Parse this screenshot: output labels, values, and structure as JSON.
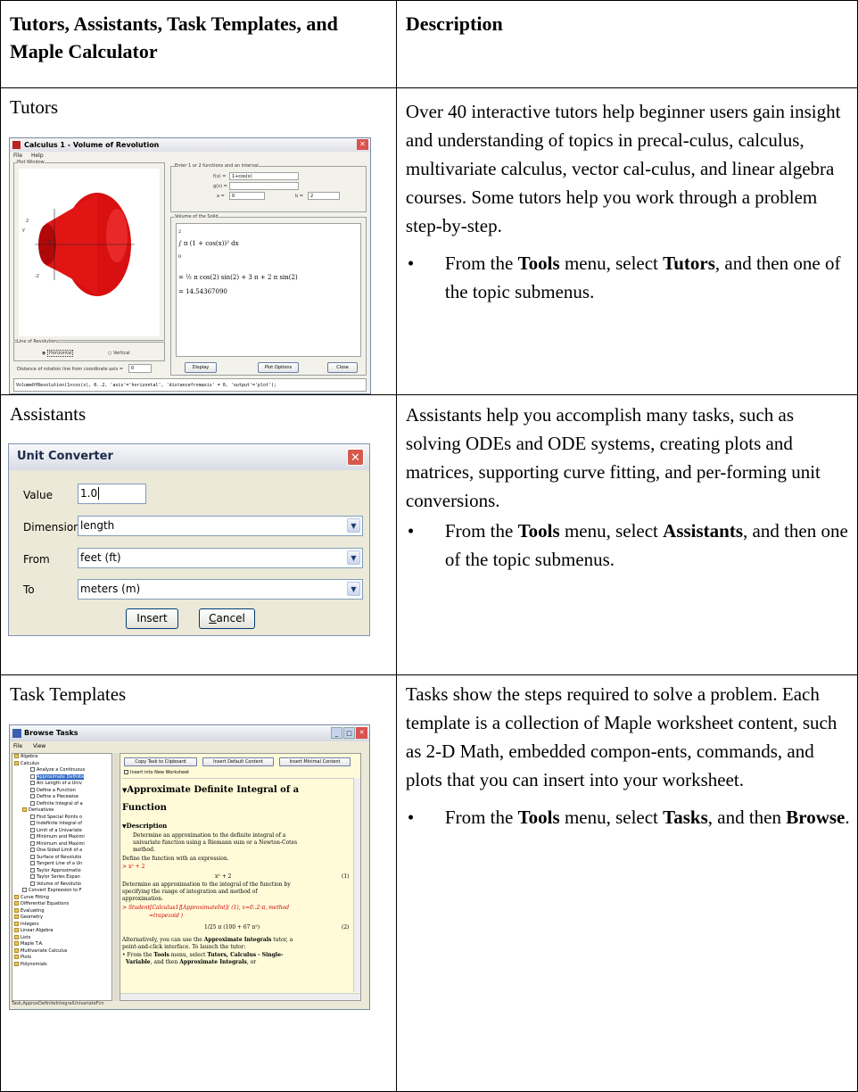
{
  "header": {
    "col1": "Tutors, Assistants, Task Templates, and Maple Calculator",
    "col2": "Description"
  },
  "rows": [
    {
      "title": "Tutors",
      "description": "Over 40 interactive tutors help beginner users gain insight and understanding of topics in precal-culus, calculus, multivariate calculus, vector cal-culus, and linear algebra courses. Some tutors help you work through a problem step-by-step.",
      "bullet": {
        "prefix": "From the ",
        "b1": "Tools",
        "mid": " menu, select ",
        "b2": "Tutors",
        "suffix": ", and then one of the topic submenus."
      }
    },
    {
      "title": "Assistants",
      "description": "Assistants help you accomplish many tasks, such as solving ODEs and ODE systems, creating plots and matrices, supporting curve fitting, and per-forming unit conversions.",
      "bullet": {
        "prefix": "From the ",
        "b1": "Tools",
        "mid": " menu, select ",
        "b2": "Assistants",
        "suffix": ", and then one of the topic submenus."
      }
    },
    {
      "title": "Task Templates",
      "description": "Tasks show the steps required to solve a problem. Each template is a collection of Maple worksheet content, such as 2-D Math, embedded compon-ents, commands, and plots that you can insert into your worksheet.",
      "bullet": {
        "prefix": "From the ",
        "b1": "Tools",
        "mid": " menu, select ",
        "b2": "Tasks",
        "suffix": ", and then ",
        "b3": "Browse",
        "end": "."
      }
    }
  ],
  "tutor_window": {
    "title": "Calculus 1 - Volume of Revolution",
    "menu": [
      "File",
      "Help"
    ],
    "plot_window": "Plot Window",
    "enter_label": "Enter 1 or 2 functions and an interval",
    "f_label": "f(x) =",
    "f_value": "1+cos(x)",
    "g_label": "g(x) =",
    "a_label": "a =",
    "a_value": "0",
    "b_label": "b =",
    "b_value": "2",
    "volume_label": "Volume of the Solid",
    "integral": "∫ π (1 + cos(x))² dx",
    "int_upper": "2",
    "int_lower": "0",
    "expr": "= ½ π cos(2) sin(2) + 3 π + 2 π sin(2)",
    "result": "= 14.54367090",
    "line_label": "Line of Revolution",
    "horizontal": "Horizontal",
    "vertical": "Vertical",
    "distance_label": "Distance of rotation line from coordinate axis =",
    "distance_value": "0",
    "display_btn": "Display",
    "plot_options_btn": "Plot Options",
    "close_btn": "Close",
    "command": "VolumeOfRevolution(1+cos(x), 0..2, 'axis'='horizontal', 'distancefromaxis' = 0, 'output'='plot');",
    "axis_labels": [
      "2",
      "y",
      "0",
      "-2",
      "x"
    ]
  },
  "unit_converter": {
    "title": "Unit Converter",
    "value_label": "Value",
    "value": "1.0",
    "dimension_label": "Dimension",
    "dimension": "length",
    "from_label": "From",
    "from": "feet (ft)",
    "to_label": "To",
    "to": "meters (m)",
    "insert": "Insert",
    "cancel": "Cancel"
  },
  "browse_tasks": {
    "title": "Browse Tasks",
    "menu": [
      "File",
      "View"
    ],
    "tree": [
      {
        "label": "Algebra",
        "type": "folder",
        "indent": 0
      },
      {
        "label": "Calculus",
        "type": "folder",
        "indent": 0
      },
      {
        "label": "Analyze a Continuous",
        "type": "page",
        "indent": 2
      },
      {
        "label": "Approximate Definite",
        "type": "page",
        "indent": 2,
        "selected": true
      },
      {
        "label": "Arc Length of a Univ",
        "type": "page",
        "indent": 2
      },
      {
        "label": "Define a Function",
        "type": "page",
        "indent": 2
      },
      {
        "label": "Define a Piecewise",
        "type": "page",
        "indent": 2
      },
      {
        "label": "Definite Integral of a",
        "type": "page",
        "indent": 2
      },
      {
        "label": "Derivatives",
        "type": "folder",
        "indent": 1
      },
      {
        "label": "Find Special Points o",
        "type": "page",
        "indent": 2
      },
      {
        "label": "Indefinite Integral of",
        "type": "page",
        "indent": 2
      },
      {
        "label": "Limit of a Univariate",
        "type": "page",
        "indent": 2
      },
      {
        "label": "Minimum and Maximi",
        "type": "page",
        "indent": 2
      },
      {
        "label": "Minimum and Maximi",
        "type": "page",
        "indent": 2
      },
      {
        "label": "One-Sided Limit of a",
        "type": "page",
        "indent": 2
      },
      {
        "label": "Surface of Revolutio",
        "type": "page",
        "indent": 2
      },
      {
        "label": "Tangent Line of a Un",
        "type": "page",
        "indent": 2
      },
      {
        "label": "Taylor Approximatio",
        "type": "page",
        "indent": 2
      },
      {
        "label": "Taylor Series Expan",
        "type": "page",
        "indent": 2
      },
      {
        "label": "Volume of Revolutio",
        "type": "page",
        "indent": 2
      },
      {
        "label": "Convert Expression to F",
        "type": "page",
        "indent": 1
      },
      {
        "label": "Curve Fitting",
        "type": "folder",
        "indent": 0
      },
      {
        "label": "Differential Equations",
        "type": "folder",
        "indent": 0
      },
      {
        "label": "Evaluating",
        "type": "folder",
        "indent": 0
      },
      {
        "label": "Geometry",
        "type": "folder",
        "indent": 0
      },
      {
        "label": "Integers",
        "type": "folder",
        "indent": 0
      },
      {
        "label": "Linear Algebra",
        "type": "folder",
        "indent": 0
      },
      {
        "label": "Lists",
        "type": "folder",
        "indent": 0
      },
      {
        "label": "Maple T.A.",
        "type": "folder",
        "indent": 0
      },
      {
        "label": "Multivariate Calculus",
        "type": "folder",
        "indent": 0
      },
      {
        "label": "Plots",
        "type": "folder",
        "indent": 0
      },
      {
        "label": "Polynomials",
        "type": "folder",
        "indent": 0
      }
    ],
    "copy_btn": "Copy Task to Clipboard",
    "insert_default_btn": "Insert Default Content",
    "insert_minimal_btn": "Insert Minimal Content",
    "insert_new_ws": "Insert into New Worksheet",
    "heading": "Approximate Definite Integral of a Function",
    "description_heading": "Description",
    "desc1": "Determine an approximation to the definite integral of a",
    "desc2": "univariate function using a Riemann sum or a Newton-Cotes",
    "desc3": "method.",
    "define_fn": "Define the function with an expression.",
    "input1": "x² + 2",
    "output1": "x² + 2",
    "eq1": "(1)",
    "det1": "Determine an approximation to the integral of the function by",
    "det2": "specifying the range of integration and method of",
    "det3": "approximation.",
    "input2": "Student[Calculus1][ApproximateInt]( (1), x=0..2·π, method",
    "input2b": "=trapezoid )",
    "output2": "1/25 π (100 + 67 π²)",
    "eq2": "(2)",
    "alt1_a": "Alternatively, you can use the ",
    "alt1_b": "Approximate Integrals",
    "alt1_c": " tutor, a",
    "alt2": "point-and-click interface. To launch the tutor:",
    "from1_a": "• From the ",
    "from1_b": "Tools",
    "from1_c": " menu, select ",
    "from1_d": "Tutors, Calculus - Single-",
    "from2_a": "Variable",
    "from2_b": ", and then ",
    "from2_c": "Approximate Integrals",
    "from2_d": ", or",
    "status": "Task,ApproxDefiniteIntegralUnivariateFcn"
  }
}
